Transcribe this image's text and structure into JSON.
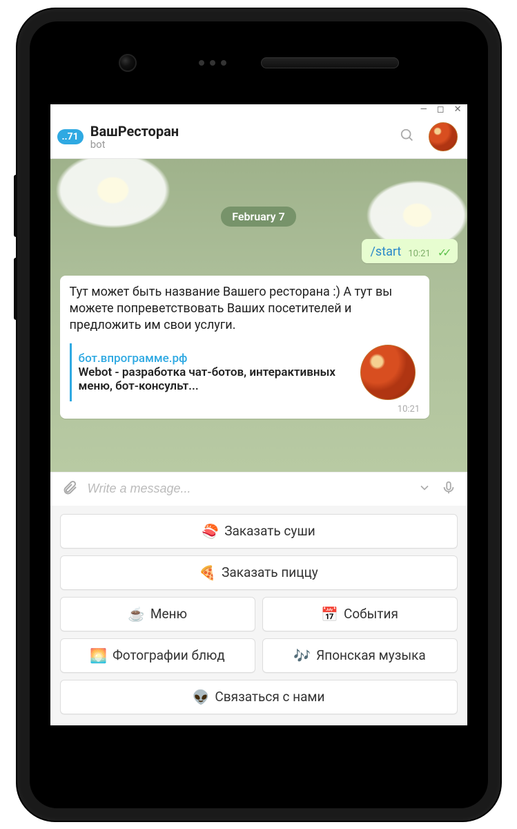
{
  "header": {
    "badge": "..71",
    "name": "ВашРесторан",
    "subtitle": "bot"
  },
  "chat": {
    "date": "February 7",
    "outgoing": {
      "text": "/start",
      "time": "10:21"
    },
    "incoming": {
      "text": "Тут может быть название Вашего ресторана :) А тут вы можете попреветствовать Ваших посетителей и предложить им свои услуги.",
      "link_url": "бот.впрограмме.рф",
      "link_desc": "Webot - разработка чат-ботов, интерактивных меню, бот-консульт...",
      "time": "10:21"
    }
  },
  "input": {
    "placeholder": "Write a message..."
  },
  "keyboard": {
    "rows": [
      [
        {
          "emoji": "🍣",
          "label": "Заказать суши"
        }
      ],
      [
        {
          "emoji": "🍕",
          "label": "Заказать пиццу"
        }
      ],
      [
        {
          "emoji": "☕",
          "label": "Меню"
        },
        {
          "emoji": "📅",
          "label": "События"
        }
      ],
      [
        {
          "emoji": "🌅",
          "label": "Фотографии блюд"
        },
        {
          "emoji": "🎶",
          "label": "Японская музыка"
        }
      ],
      [
        {
          "emoji": "👽",
          "label": "Связаться с нами"
        }
      ]
    ]
  }
}
